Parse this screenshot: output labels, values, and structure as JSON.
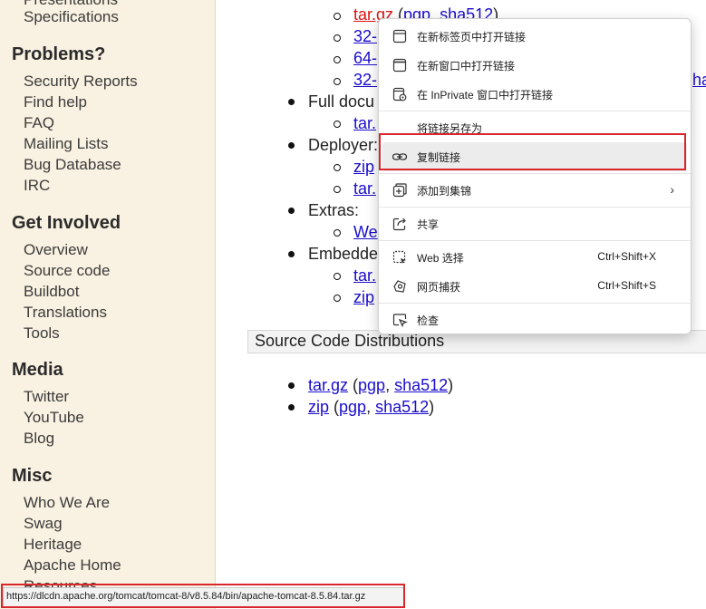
{
  "sidebar": {
    "top_cut_1": "Presentations",
    "top_cut_2": "Specifications",
    "sections": [
      {
        "heading": "Problems?",
        "items": [
          "Security Reports",
          "Find help",
          "FAQ",
          "Mailing Lists",
          "Bug Database",
          "IRC"
        ]
      },
      {
        "heading": "Get Involved",
        "items": [
          "Overview",
          "Source code",
          "Buildbot",
          "Translations",
          "Tools"
        ]
      },
      {
        "heading": "Media",
        "items": [
          "Twitter",
          "YouTube",
          "Blog"
        ]
      },
      {
        "heading": "Misc",
        "items": [
          "Who We Are",
          "Swag",
          "Heritage",
          "Apache Home",
          "Resources"
        ]
      }
    ]
  },
  "main": {
    "top_line": {
      "tar": "tar.gz",
      "open": " (",
      "pgp": "pgp",
      "comma": ", ",
      "sha": "sha512",
      "close": ")"
    },
    "sub_links": [
      "32-",
      "64-",
      "32-"
    ],
    "cut_right": "ha",
    "full_doc": "Full docu",
    "full_doc_sub": "tar.",
    "deployer": "Deployer:",
    "deployer_subs": [
      "zip",
      "tar."
    ],
    "extras": "Extras:",
    "extras_sub": "We",
    "embedded": "Embedde",
    "embedded_subs": [
      "tar.",
      "zip"
    ],
    "source_heading": "Source Code Distributions",
    "source_items": [
      {
        "name": "tar.gz",
        "pgp": "pgp",
        "sha": "sha512"
      },
      {
        "name": "zip",
        "pgp": "pgp",
        "sha": "sha512"
      }
    ],
    "punct": {
      "open": " (",
      "comma": ", ",
      "close": ")"
    }
  },
  "context_menu": {
    "items": [
      {
        "label": "在新标签页中打开链接",
        "icon": "new-tab-icon"
      },
      {
        "label": "在新窗口中打开链接",
        "icon": "new-window-icon"
      },
      {
        "label": "在 InPrivate 窗口中打开链接",
        "icon": "inprivate-window-icon"
      },
      {
        "label": "将链接另存为"
      },
      {
        "label": "复制链接",
        "icon": "link-icon",
        "highlighted": true
      },
      {
        "label": "添加到集锦",
        "icon": "collections-icon",
        "submenu": true
      },
      {
        "label": "共享",
        "icon": "share-icon"
      },
      {
        "label": "Web 选择",
        "icon": "web-select-icon",
        "shortcut": "Ctrl+Shift+X"
      },
      {
        "label": "网页捕获",
        "icon": "web-capture-icon",
        "shortcut": "Ctrl+Shift+S"
      },
      {
        "label": "检查",
        "icon": "inspect-icon"
      }
    ]
  },
  "status_bar": {
    "url": "https://dlcdn.apache.org/tomcat/tomcat-8/v8.5.84/bin/apache-tomcat-8.5.84.tar.gz"
  },
  "colors": {
    "sidebar_bg": "#f9f1e1",
    "link": "#1a0dcc",
    "visited_red": "#d11",
    "highlight_border": "#d8262b"
  }
}
